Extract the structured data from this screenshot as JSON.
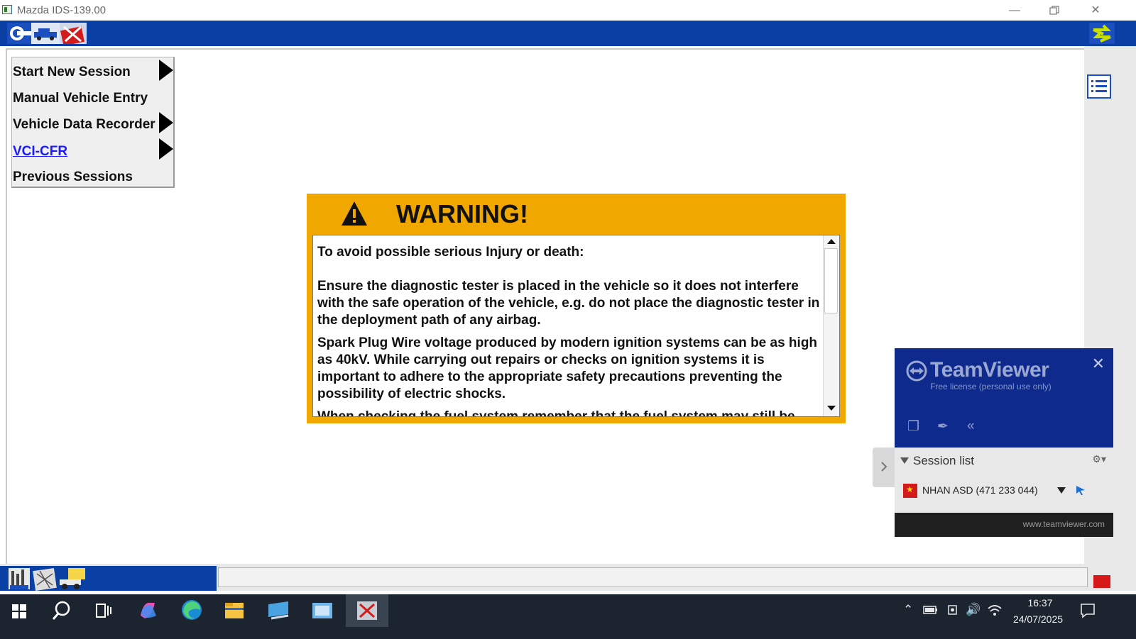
{
  "window": {
    "title": "Mazda IDS-139.00"
  },
  "menu": {
    "items": [
      {
        "label": "Start New Session"
      },
      {
        "label": "Manual Vehicle Entry"
      },
      {
        "label": "Vehicle Data Recorder"
      },
      {
        "label": "VCI-CFR"
      },
      {
        "label": "Previous Sessions"
      }
    ]
  },
  "warning": {
    "title": "WARNING!",
    "paragraphs": [
      "To avoid possible serious Injury or death:",
      "Ensure the diagnostic tester is placed in the vehicle so it does not interfere with the safe operation of the vehicle, e.g. do not place the diagnostic tester in the deployment path of any airbag.",
      "Spark Plug Wire voltage produced by modern ignition systems can be as high as 40kV. While carrying out repairs or checks on ignition systems it is important to adhere to the appropriate safety precautions preventing the possibility of electric shocks.",
      "When checking the fuel system remember that the fuel system may still be"
    ]
  },
  "teamviewer": {
    "brand": "TeamViewer",
    "license": "Free license (personal use only)",
    "session_list_label": "Session list",
    "session_entry": "NHAN ASD (471 233 044)",
    "url": "www.teamviewer.com"
  },
  "taskbar": {
    "time": "16:37",
    "date": "24/07/2025"
  },
  "colors": {
    "ids_blue": "#0a3fa3",
    "warning_amber": "#f0a800",
    "link_blue": "#1a1aff",
    "teamviewer_navy": "#0e2a8c"
  }
}
